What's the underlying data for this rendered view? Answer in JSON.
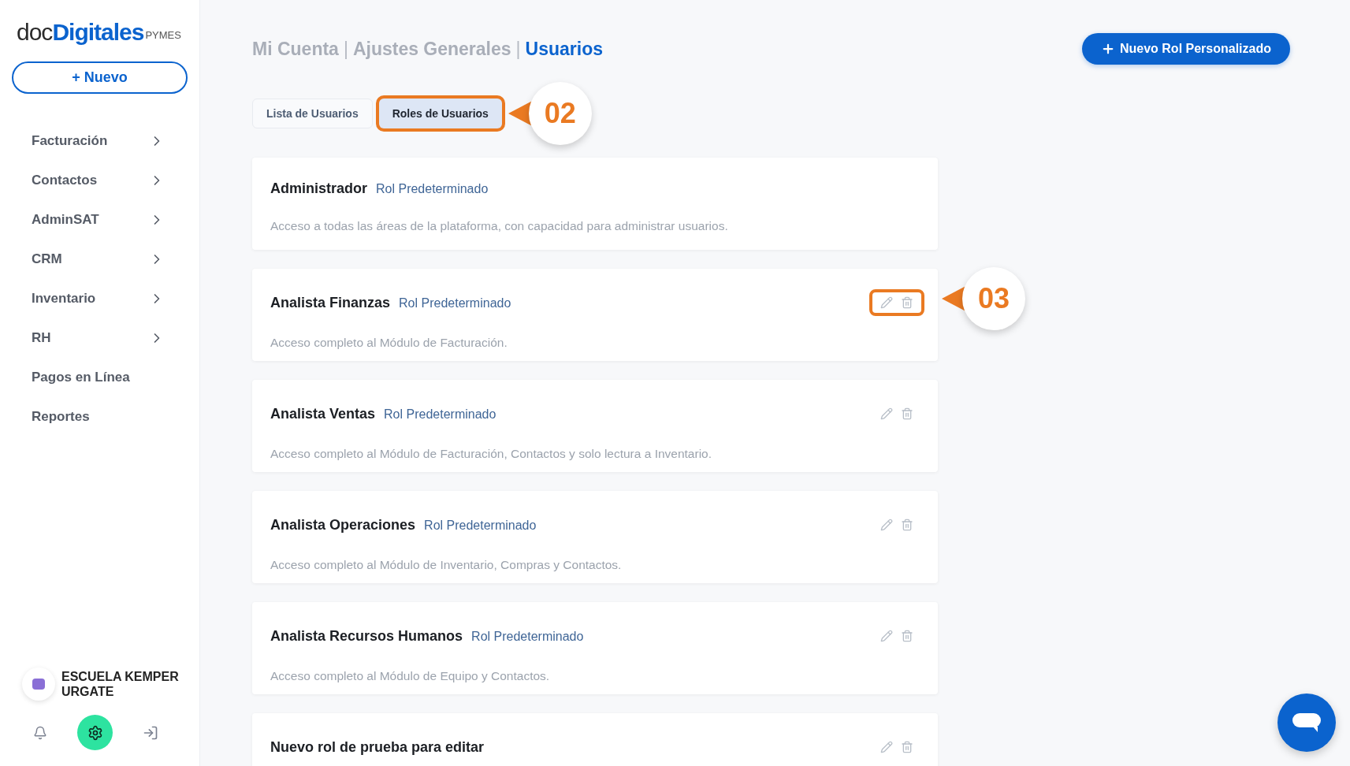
{
  "sidebar": {
    "logo": {
      "part_1": "doc",
      "part_2": "Digitales",
      "suffix": "PYMES"
    },
    "new_button": "+ Nuevo",
    "items": [
      {
        "label": "Facturación",
        "has_children": true
      },
      {
        "label": "Contactos",
        "has_children": true
      },
      {
        "label": "AdminSAT",
        "has_children": true
      },
      {
        "label": "CRM",
        "has_children": true
      },
      {
        "label": "Inventario",
        "has_children": true
      },
      {
        "label": "RH",
        "has_children": true
      },
      {
        "label": "Pagos en Línea",
        "has_children": false
      },
      {
        "label": "Reportes",
        "has_children": false
      }
    ],
    "account": {
      "name": "ESCUELA KEMPER URGATE"
    },
    "footer_buttons": [
      {
        "kind": "bell",
        "selected": false
      },
      {
        "kind": "settings",
        "selected": true
      },
      {
        "kind": "logout",
        "selected": false
      }
    ]
  },
  "breadcrumb": [
    {
      "label": "Mi Cuenta",
      "current": false
    },
    {
      "label": "Ajustes Generales",
      "current": false
    },
    {
      "label": "Usuarios",
      "current": true
    }
  ],
  "breadcrumb_separator": "|",
  "primary_button": "Nuevo Rol Personalizado",
  "tabs": [
    {
      "label": "Lista de Usuarios",
      "selected": false,
      "highlighted": false
    },
    {
      "label": "Roles de Usuarios",
      "selected": true,
      "highlighted": true,
      "callout": "02"
    }
  ],
  "roles": [
    {
      "name": "Administrador",
      "tag": "Rol Predeterminado",
      "description": "Acceso a todas las áreas de la plataforma, con capacidad para administrar usuarios.",
      "actions": false
    },
    {
      "name": "Analista Finanzas",
      "tag": "Rol Predeterminado",
      "description": "Acceso completo al Módulo de Facturación.",
      "actions": true,
      "highlighted": true,
      "callout": "03"
    },
    {
      "name": "Analista Ventas",
      "tag": "Rol Predeterminado",
      "description": "Acceso completo al Módulo de Facturación, Contactos y solo lectura a Inventario.",
      "actions": true,
      "highlighted": false
    },
    {
      "name": "Analista Operaciones",
      "tag": "Rol Predeterminado",
      "description": "Acceso completo al Módulo de Inventario, Compras y Contactos.",
      "actions": true,
      "highlighted": false
    },
    {
      "name": "Analista Recursos Humanos",
      "tag": "Rol Predeterminado",
      "description": "Acceso completo al Módulo de Equipo y Contactos.",
      "actions": true,
      "highlighted": false
    },
    {
      "name": "Nuevo rol de prueba para editar",
      "actions": true,
      "highlighted": false
    }
  ]
}
